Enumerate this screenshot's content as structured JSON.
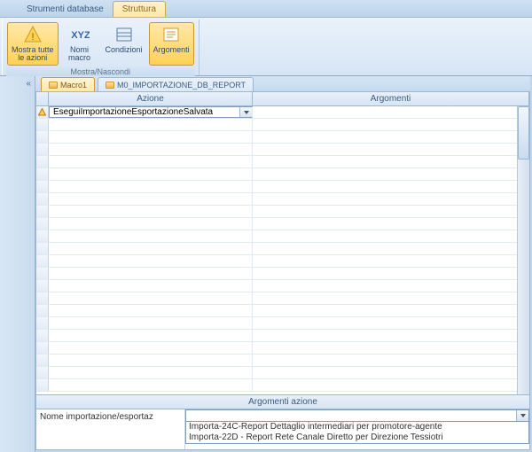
{
  "ribbon": {
    "tabs": {
      "db_tools": "Strumenti database",
      "structure": "Struttura"
    },
    "group_title": "Mostra/Nascondi",
    "buttons": {
      "show_all": "Mostra tutte\nle azioni",
      "macro_names": "Nomi\nmacro",
      "conditions": "Condizioni",
      "arguments": "Argomenti"
    }
  },
  "doc_tabs": {
    "active": "Macro1",
    "other": "M0_IMPORTAZIONE_DB_REPORT"
  },
  "grid": {
    "header_action": "Azione",
    "header_args": "Argomenti",
    "selected_action": "EseguiImportazioneEsportazioneSalvata"
  },
  "args": {
    "section_title": "Argomenti azione",
    "label": "Nome importazione/esportaz",
    "options": [
      "Importa-24C-Report Dettaglio intermediari per promotore-agente",
      "Importa-22D - Report Rete Canale Diretto per Direzione Tessiotri"
    ]
  }
}
